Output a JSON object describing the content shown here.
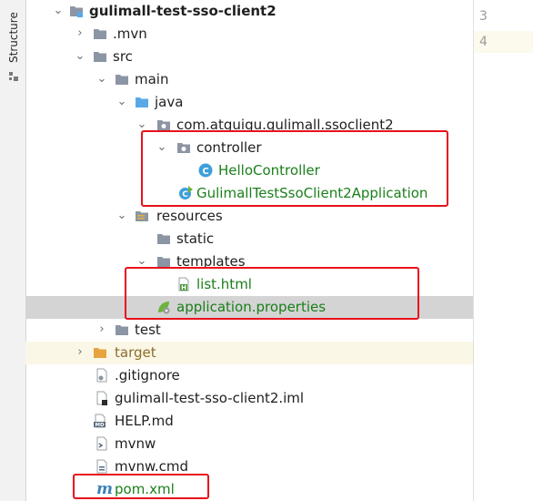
{
  "sidebar": {
    "tab_label": "Structure"
  },
  "editor": {
    "line_numbers": [
      "3",
      "4"
    ]
  },
  "tree": {
    "root": "gulimall-test-sso-client2",
    "mvn": ".mvn",
    "src": "src",
    "main": "main",
    "java": "java",
    "package": "com.atguigu.gulimall.ssoclient2",
    "controller": "controller",
    "hello_controller": "HelloController",
    "app_class": "GulimallTestSsoClient2Application",
    "resources": "resources",
    "static": "static",
    "templates": "templates",
    "list_html": "list.html",
    "app_properties": "application.properties",
    "test": "test",
    "target": "target",
    "gitignore": ".gitignore",
    "iml": "gulimall-test-sso-client2.iml",
    "help": "HELP.md",
    "mvnw": "mvnw",
    "mvnw_cmd": "mvnw.cmd",
    "pom": "pom.xml"
  },
  "colors": {
    "accent_red": "#e8101a",
    "git_green": "#1a7f1a",
    "folder": "#8c95a3",
    "source_folder": "#5aa9e6",
    "class_icon": "#3d9fd9",
    "spring_green": "#6db33f"
  }
}
